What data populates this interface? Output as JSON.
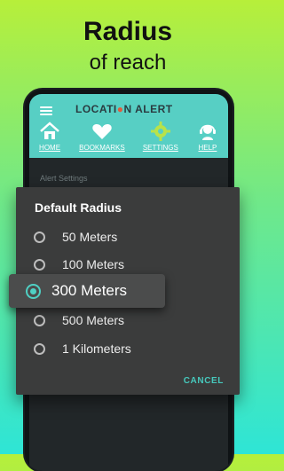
{
  "promo": {
    "title": "Radius",
    "subtitle": "of reach"
  },
  "app": {
    "logo": {
      "part1": "LOCATI",
      "part2": "N ALERT"
    },
    "nav": [
      {
        "label": "HOME",
        "icon": "home-icon"
      },
      {
        "label": "BOOKMARKS",
        "icon": "heart-icon"
      },
      {
        "label": "SETTINGS",
        "icon": "gear-icon"
      },
      {
        "label": "HELP",
        "icon": "headset-icon"
      }
    ],
    "section_label": "Alert Settings"
  },
  "dialog": {
    "title": "Default Radius",
    "options": [
      "50 Meters",
      "100 Meters",
      "300 Meters",
      "500 Meters",
      "1 Kilometers"
    ],
    "selected": "300 Meters",
    "cancel_label": "CANCEL"
  },
  "colors": {
    "accent": "#4fd0c4",
    "header": "#57cfc4",
    "dialog_bg": "#3b3c3c"
  }
}
